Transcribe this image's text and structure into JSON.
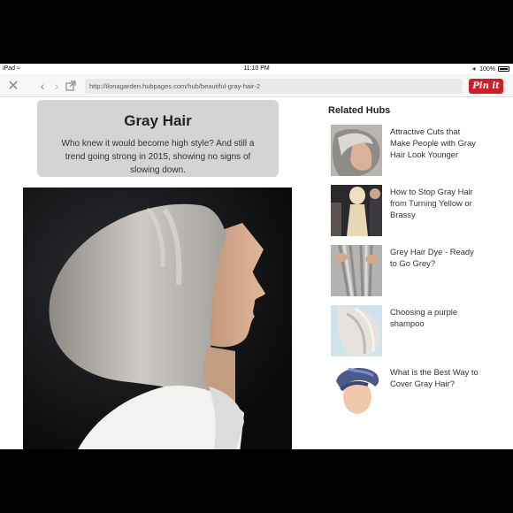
{
  "status_bar": {
    "device": "iPad",
    "time": "11:10 PM",
    "battery": "100%"
  },
  "toolbar": {
    "url": "http://ilonagarden.hubpages.com/hub/beautiful-gray-hair-2",
    "pin_label": "Pin it",
    "pin_color": "#cb2027"
  },
  "article": {
    "title": "Gray Hair",
    "subtitle": "Who knew it would become high style? And still a trend going strong in 2015, showing no signs of slowing down."
  },
  "related": {
    "heading": "Related Hubs",
    "items": [
      {
        "label": "Attractive Cuts that Make People with Gray Hair Look Younger"
      },
      {
        "label": "How to Stop Gray Hair from Turning Yellow or Brassy"
      },
      {
        "label": "Grey Hair Dye - Ready to Go Grey?"
      },
      {
        "label": "Choosing a purple shampoo"
      },
      {
        "label": "What is the Best Way to Cover Gray Hair?"
      }
    ]
  }
}
